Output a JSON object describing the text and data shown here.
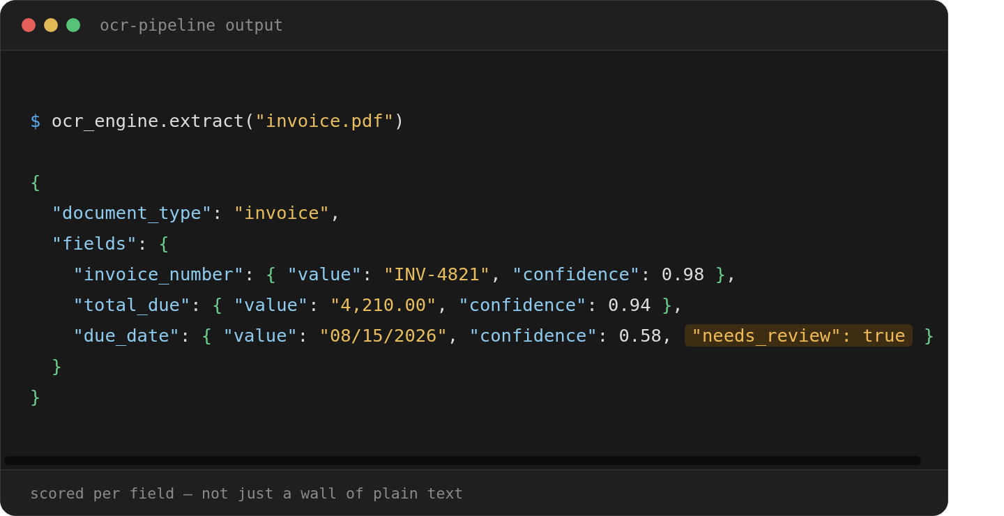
{
  "window": {
    "title": "ocr-pipeline output"
  },
  "lines": [
    {
      "kind": "code",
      "segments": [
        {
          "highlighted": false,
          "tokens": [
            {
              "kind": "prompt",
              "t": "$ "
            },
            {
              "kind": "plain",
              "t": "ocr_engine.extract("
            },
            {
              "kind": "string",
              "t": "\"invoice.pdf\""
            },
            {
              "kind": "plain",
              "t": ")"
            }
          ]
        }
      ]
    },
    {
      "kind": "blank"
    },
    {
      "kind": "code",
      "segments": [
        {
          "highlighted": false,
          "tokens": [
            {
              "kind": "brace",
              "t": "{"
            }
          ]
        }
      ]
    },
    {
      "kind": "code",
      "segments": [
        {
          "highlighted": false,
          "tokens": [
            {
              "kind": "key",
              "t": "  \"document_type\""
            },
            {
              "kind": "plain",
              "t": ": "
            },
            {
              "kind": "string",
              "t": "\"invoice\""
            },
            {
              "kind": "plain",
              "t": ","
            }
          ]
        }
      ]
    },
    {
      "kind": "code",
      "segments": [
        {
          "highlighted": false,
          "tokens": [
            {
              "kind": "key",
              "t": "  \"fields\""
            },
            {
              "kind": "plain",
              "t": ": "
            },
            {
              "kind": "brace",
              "t": "{"
            }
          ]
        }
      ]
    },
    {
      "kind": "code",
      "segments": [
        {
          "highlighted": false,
          "tokens": [
            {
              "kind": "key",
              "t": "    \"invoice_number\""
            },
            {
              "kind": "plain",
              "t": ": "
            },
            {
              "kind": "brace",
              "t": "{ "
            },
            {
              "kind": "key",
              "t": "\"value\""
            },
            {
              "kind": "plain",
              "t": ": "
            },
            {
              "kind": "string",
              "t": "\"INV-4821\""
            },
            {
              "kind": "plain",
              "t": ", "
            },
            {
              "kind": "key",
              "t": "\"confidence\""
            },
            {
              "kind": "plain",
              "t": ": 0.98 "
            },
            {
              "kind": "brace",
              "t": "}"
            },
            {
              "kind": "plain",
              "t": ","
            }
          ]
        }
      ]
    },
    {
      "kind": "code",
      "segments": [
        {
          "highlighted": false,
          "tokens": [
            {
              "kind": "key",
              "t": "    \"total_due\""
            },
            {
              "kind": "plain",
              "t": ": "
            },
            {
              "kind": "brace",
              "t": "{ "
            },
            {
              "kind": "key",
              "t": "\"value\""
            },
            {
              "kind": "plain",
              "t": ": "
            },
            {
              "kind": "string",
              "t": "\"4,210.00\""
            },
            {
              "kind": "plain",
              "t": ", "
            },
            {
              "kind": "key",
              "t": "\"confidence\""
            },
            {
              "kind": "plain",
              "t": ": 0.94 "
            },
            {
              "kind": "brace",
              "t": "}"
            },
            {
              "kind": "plain",
              "t": ","
            }
          ]
        }
      ]
    },
    {
      "kind": "code",
      "segments": [
        {
          "highlighted": false,
          "tokens": [
            {
              "kind": "key",
              "t": "    \"due_date\""
            },
            {
              "kind": "plain",
              "t": ": "
            },
            {
              "kind": "brace",
              "t": "{ "
            },
            {
              "kind": "key",
              "t": "\"value\""
            },
            {
              "kind": "plain",
              "t": ": "
            },
            {
              "kind": "string",
              "t": "\"08/15/2026\""
            },
            {
              "kind": "plain",
              "t": ", "
            },
            {
              "kind": "key",
              "t": "\"confidence\""
            },
            {
              "kind": "plain",
              "t": ": 0.58, "
            }
          ]
        },
        {
          "highlighted": true,
          "tokens": [
            {
              "kind": "flag",
              "t": "\"needs_review\": true"
            }
          ]
        },
        {
          "highlighted": false,
          "tokens": [
            {
              "kind": "brace",
              "t": "}"
            }
          ]
        }
      ]
    },
    {
      "kind": "code",
      "segments": [
        {
          "highlighted": false,
          "tokens": [
            {
              "kind": "brace",
              "t": "  }"
            }
          ]
        }
      ]
    },
    {
      "kind": "code",
      "segments": [
        {
          "highlighted": false,
          "tokens": [
            {
              "kind": "brace",
              "t": "}"
            }
          ]
        }
      ]
    }
  ],
  "footer": "scored per field — not just a wall of plain text"
}
